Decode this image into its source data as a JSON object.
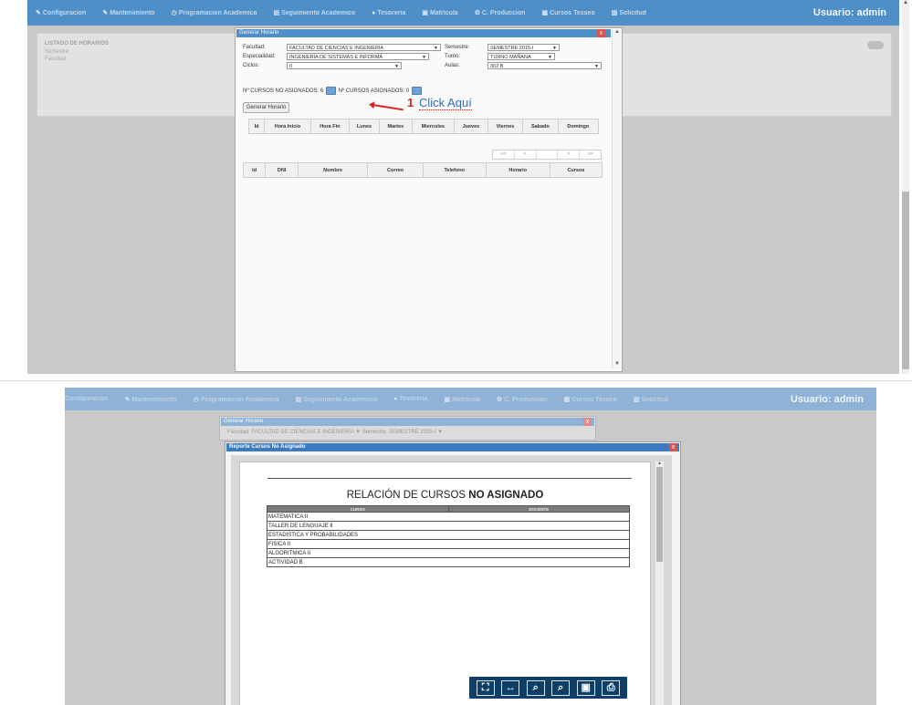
{
  "nav": {
    "items": [
      {
        "label": "Configuracion",
        "icon": "wrench-icon"
      },
      {
        "label": "Mantenimiento",
        "icon": "wrench-icon"
      },
      {
        "label": "Programacion Academica",
        "icon": "clock-icon"
      },
      {
        "label": "Seguimiento Academico",
        "icon": "chart-icon"
      },
      {
        "label": "Tesoreria",
        "icon": "coins-icon"
      },
      {
        "label": "Matricula",
        "icon": "folder-icon"
      },
      {
        "label": "C. Produccion",
        "icon": "gear-icon"
      },
      {
        "label": "Cursos Tesseo",
        "icon": "book-icon"
      },
      {
        "label": "Solicitud",
        "icon": "document-icon"
      }
    ],
    "user_label": "Usuario:",
    "user_name": "admin"
  },
  "background_panel": {
    "title": "LISTADO DE HORARIOS",
    "line1": "Semestre:",
    "line2": "Facultad:"
  },
  "dialog": {
    "title": "Generar Horario",
    "close": "x",
    "facultad_label": "Facultad:",
    "facultad_value": "FACULTAD DE CIENCIAS E INGENIERÍA",
    "semestre_label": "Semestre:",
    "semestre_value": "SEMESTRE 2015-I",
    "especialidad_label": "Especialidad:",
    "especialidad_value": "INGENIERÍA DE SISTEMAS E INFORMÁ",
    "turno_label": "Turno:",
    "turno_value": "TURNO MAÑANA",
    "ciclos_label": "Ciclos:",
    "ciclos_value": "II",
    "aulas_label": "Aulas:",
    "aulas_value": "302 B",
    "no_asignados_label": "Nº CURSOS NO ASIGNADOS: 6",
    "asignados_label": "Nº CURSOS ASIGNADOS: 0",
    "annotation_number": "1",
    "annotation_text": "Click Aquí",
    "generate_button": "Generar Horario",
    "schedule_headers": [
      "Id",
      "Hora Inicio",
      "Hora Fin",
      "Lunes",
      "Martes",
      "Miercoles",
      "Jueves",
      "Viernes",
      "Sabado",
      "Domingo"
    ],
    "teacher_headers": [
      "Id",
      "DNI",
      "Nombre",
      "Correo",
      "Telefono",
      "Horario",
      "Cursos"
    ],
    "pager": [
      "<<",
      "<",
      "",
      ">",
      ">>"
    ]
  },
  "bottom": {
    "dialog_title": "Generar Horario",
    "facultad_row": "Facultad:    FACULTAD DE CIENCIAS E INGENIERÍA   ▼   Semestre:   SEMESTRE 2015-I  ▼",
    "report_title": "Reporte Cursos No Asignado",
    "report_close": "x",
    "heading_regular": "RELACIÓN DE CURSOS ",
    "heading_bold": "NO ASIGNADO",
    "col_curso": "CURSO",
    "col_docente": "DOCENTE",
    "courses": [
      "MATEMATICA II",
      "TALLER DE LENGUAJE II",
      "ESTADISTICA Y PROBABILIDADES",
      "FISICA II",
      "ALGORITMICA II",
      "ACTIVIDAD B"
    ],
    "toolbar": [
      {
        "name": "fit-page-icon",
        "glyph": "⛶"
      },
      {
        "name": "fit-width-icon",
        "glyph": "↔"
      },
      {
        "name": "zoom-out-icon",
        "glyph": "🔍"
      },
      {
        "name": "zoom-in-icon",
        "glyph": "🔍"
      },
      {
        "name": "save-icon",
        "glyph": "💾"
      },
      {
        "name": "print-icon",
        "glyph": "⎙"
      }
    ]
  }
}
